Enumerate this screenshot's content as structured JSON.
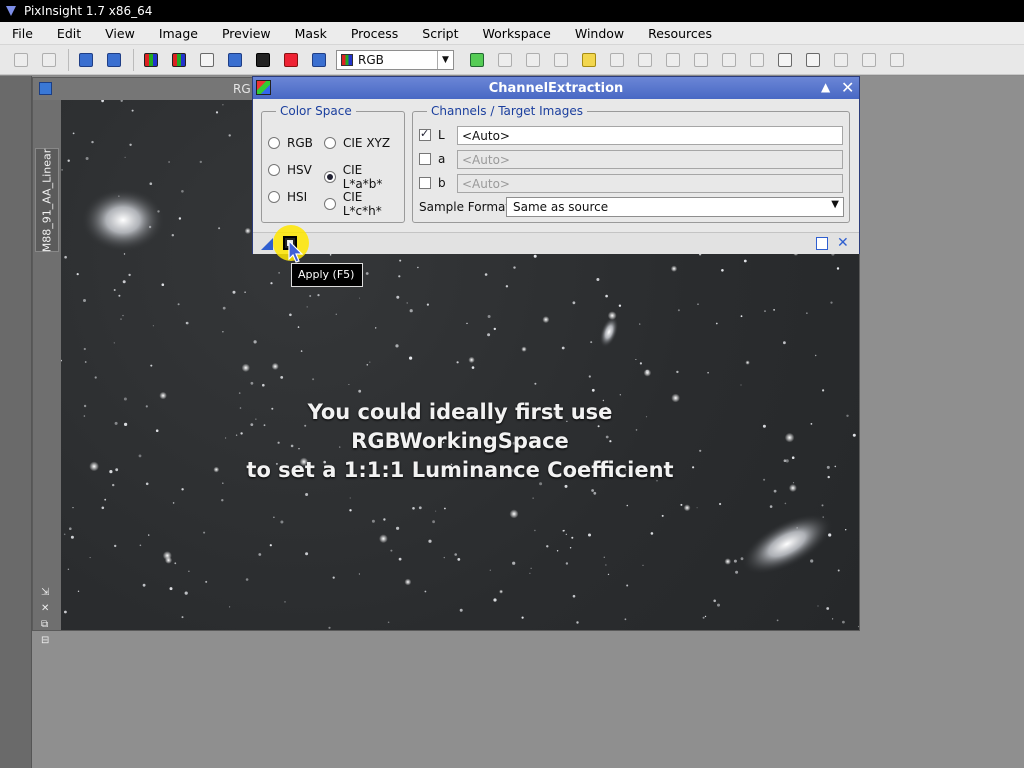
{
  "app": {
    "title": "PixInsight 1.7 x86_64"
  },
  "menu": [
    "File",
    "Edit",
    "View",
    "Image",
    "Preview",
    "Mask",
    "Process",
    "Script",
    "Workspace",
    "Window",
    "Resources"
  ],
  "toolbar": {
    "rgb_select": "RGB"
  },
  "image_window": {
    "title_partial": "RG",
    "tab_label": "M88_91_AA_Linear",
    "caption_lines": [
      "You could ideally first use",
      "RGBWorkingSpace",
      "to set a 1:1:1 Luminance Coefficient"
    ]
  },
  "dialog": {
    "title": "ChannelExtraction",
    "color_space": {
      "title": "Color Space",
      "options": [
        "RGB",
        "CIE XYZ",
        "HSV",
        "CIE L*a*b*",
        "HSI",
        "CIE L*c*h*"
      ],
      "selected": "CIE L*a*b*"
    },
    "channels": {
      "title": "Channels / Target Images",
      "rows": [
        {
          "label": "L",
          "checked": true,
          "value": "<Auto>"
        },
        {
          "label": "a",
          "checked": false,
          "value": "<Auto>"
        },
        {
          "label": "b",
          "checked": false,
          "value": "<Auto>"
        }
      ],
      "sample_format_label": "Sample Format:",
      "sample_format_value": "Same as source"
    }
  },
  "tooltip": "Apply (F5)"
}
